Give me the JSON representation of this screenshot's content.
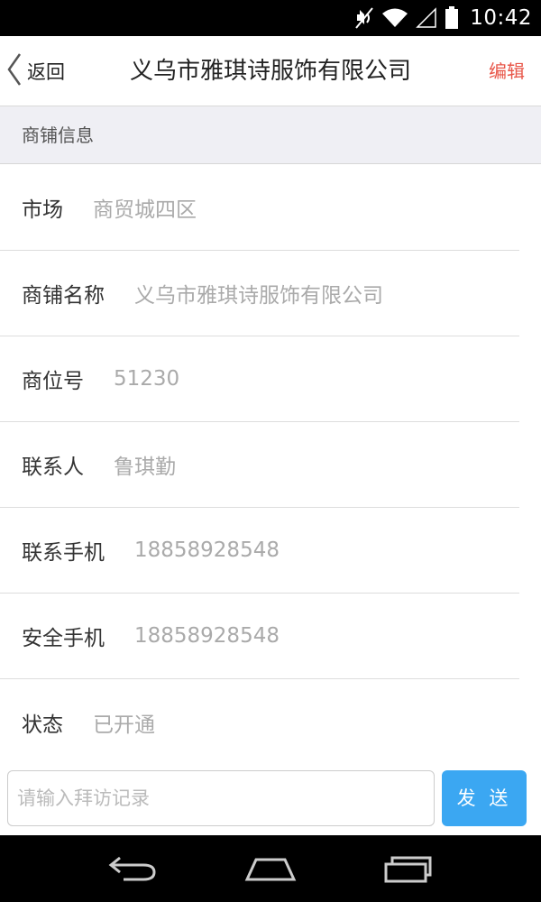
{
  "status_bar": {
    "time": "10:42",
    "icons": [
      "mute-icon",
      "wifi-icon",
      "signal-icon",
      "battery-icon"
    ]
  },
  "header": {
    "back_label": "返回",
    "title": "义乌市雅琪诗服饰有限公司",
    "edit_label": "编辑"
  },
  "section": {
    "title": "商铺信息"
  },
  "info_rows": [
    {
      "label": "市场",
      "value": "商贸城四区"
    },
    {
      "label": "商铺名称",
      "value": "义乌市雅琪诗服饰有限公司"
    },
    {
      "label": "商位号",
      "value": "51230"
    },
    {
      "label": "联系人",
      "value": "鲁琪勤"
    },
    {
      "label": "联系手机",
      "value": "18858928548"
    },
    {
      "label": "安全手机",
      "value": "18858928548"
    },
    {
      "label": "状态",
      "value": "已开通"
    }
  ],
  "input_bar": {
    "placeholder": "请输入拜访记录",
    "send_label": "发 送"
  },
  "nav_bar": {
    "buttons": [
      "back-nav-icon",
      "home-nav-icon",
      "recents-nav-icon"
    ]
  },
  "colors": {
    "accent_blue": "#3ba7f2",
    "edit_red": "#e8574a",
    "section_bg": "#efeff4"
  }
}
